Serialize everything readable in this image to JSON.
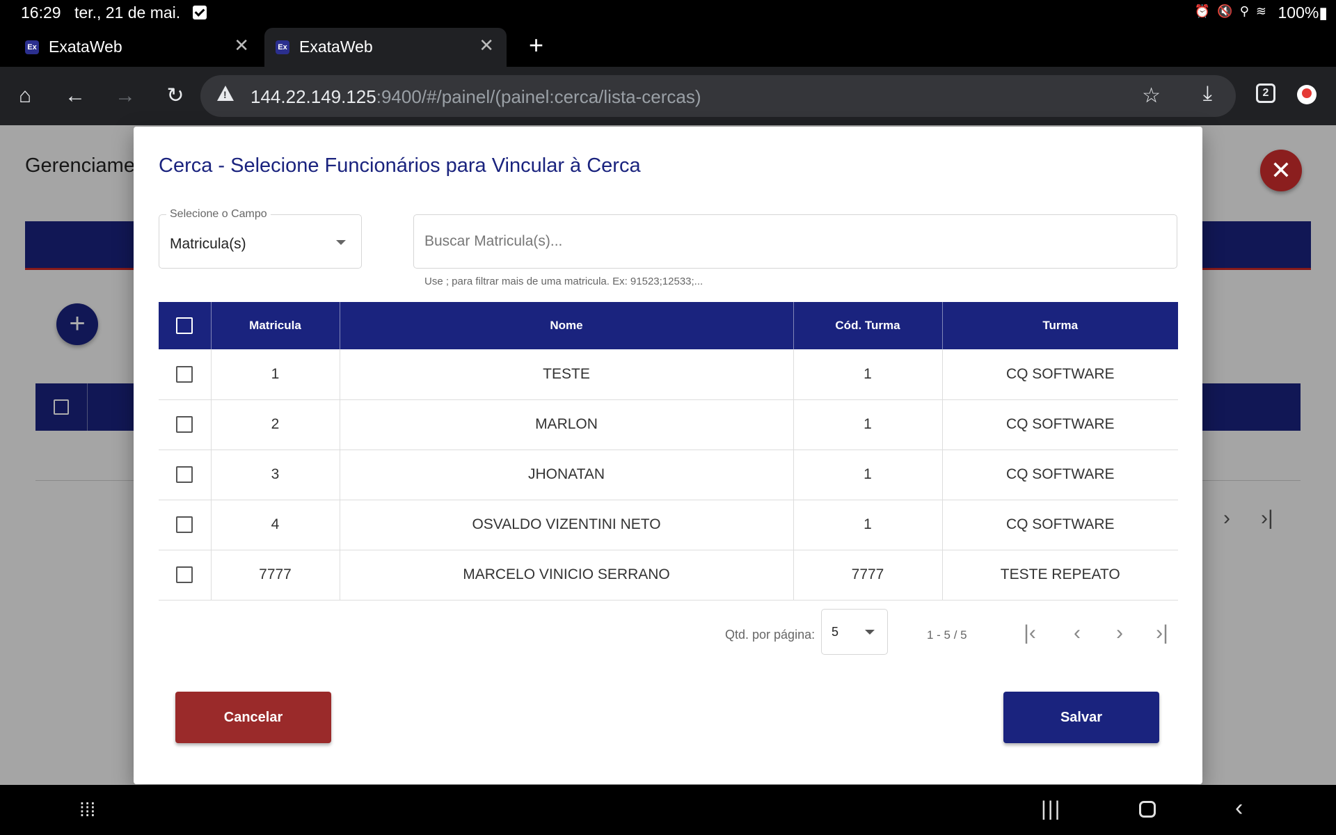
{
  "status_bar": {
    "time": "16:29",
    "date": "ter., 21 de mai.",
    "battery": "100%"
  },
  "browser": {
    "tabs": [
      {
        "title": "ExataWeb",
        "favicon": "Ex"
      },
      {
        "title": "ExataWeb",
        "favicon": "Ex"
      }
    ],
    "tab_count": "2",
    "url_host": "144.22.149.125",
    "url_rest": ":9400/#/painel/(painel:cerca/lista-cercas)"
  },
  "page": {
    "title": "Gerenciame"
  },
  "modal": {
    "title": "Cerca - Selecione Funcionários para Vincular à Cerca",
    "field_label": "Selecione o Campo",
    "field_value": "Matricula(s)",
    "search_placeholder": "Buscar Matricula(s)...",
    "hint": "Use ; para filtrar mais de uma matricula. Ex: 91523;12533;...",
    "columns": [
      "Matricula",
      "Nome",
      "Cód. Turma",
      "Turma"
    ],
    "rows": [
      {
        "matricula": "1",
        "nome": "TESTE",
        "cod_turma": "1",
        "turma": "CQ SOFTWARE"
      },
      {
        "matricula": "2",
        "nome": "MARLON",
        "cod_turma": "1",
        "turma": "CQ SOFTWARE"
      },
      {
        "matricula": "3",
        "nome": "JHONATAN",
        "cod_turma": "1",
        "turma": "CQ SOFTWARE"
      },
      {
        "matricula": "4",
        "nome": "OSVALDO VIZENTINI NETO",
        "cod_turma": "1",
        "turma": "CQ SOFTWARE"
      },
      {
        "matricula": "7777",
        "nome": "MARCELO VINICIO SERRANO",
        "cod_turma": "7777",
        "turma": "TESTE REPEATO"
      }
    ],
    "page_size_label": "Qtd. por página:",
    "page_size": "5",
    "range": "1 - 5 / 5",
    "cancel_label": "Cancelar",
    "save_label": "Salvar"
  },
  "colors": {
    "primary": "#1a237e",
    "danger": "#9a2a2a",
    "accent_line": "#c62828"
  }
}
